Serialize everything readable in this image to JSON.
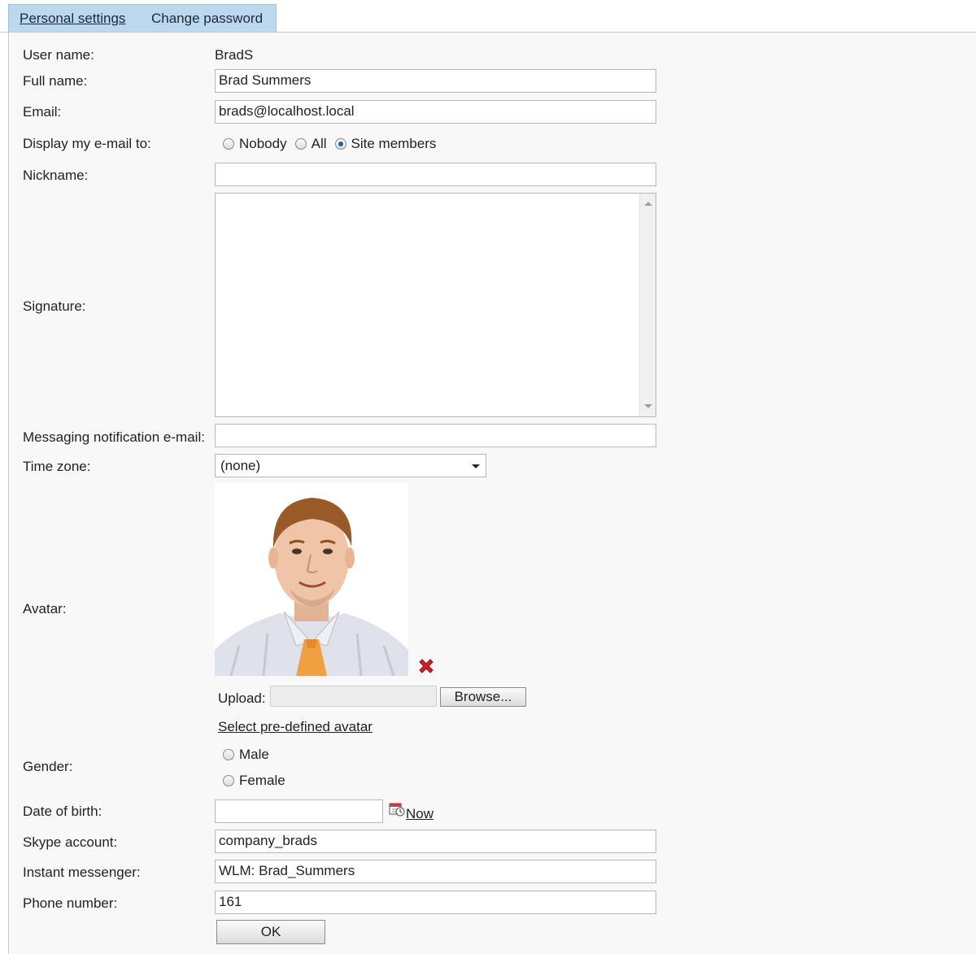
{
  "tabs": [
    {
      "label": "Personal settings",
      "active": true
    },
    {
      "label": "Change password",
      "active": false
    }
  ],
  "form": {
    "username_label": "User name:",
    "username_value": "BradS",
    "fullname_label": "Full name:",
    "fullname_value": "Brad Summers",
    "email_label": "Email:",
    "email_value": "brads@localhost.local",
    "display_email_label": "Display my e-mail to:",
    "display_email_options": [
      {
        "label": "Nobody",
        "checked": false
      },
      {
        "label": "All",
        "checked": false
      },
      {
        "label": "Site members",
        "checked": true
      }
    ],
    "nickname_label": "Nickname:",
    "nickname_value": "",
    "signature_label": "Signature:",
    "signature_value": "",
    "messaging_label": "Messaging notification e-mail:",
    "messaging_value": "",
    "timezone_label": "Time zone:",
    "timezone_value": "(none)",
    "avatar_label": "Avatar:",
    "upload_label": "Upload:",
    "browse_label": "Browse...",
    "predefined_avatar_link": "Select pre-defined avatar",
    "gender_label": "Gender:",
    "gender_options": [
      {
        "label": "Male",
        "checked": false
      },
      {
        "label": "Female",
        "checked": false
      }
    ],
    "dob_label": "Date of birth:",
    "dob_value": "",
    "now_link": "Now",
    "skype_label": "Skype account:",
    "skype_value": "company_brads",
    "im_label": "Instant messenger:",
    "im_value": "WLM: Brad_Summers",
    "phone_label": "Phone number:",
    "phone_value": "161",
    "ok_label": "OK"
  },
  "icons": {
    "delete": "delete-x-icon",
    "calendar": "calendar-icon",
    "dropdown": "chevron-down-icon"
  },
  "colors": {
    "tab_bg": "#bcd8ef",
    "panel_bg": "#f8f8f8",
    "delete_red": "#d42020"
  }
}
